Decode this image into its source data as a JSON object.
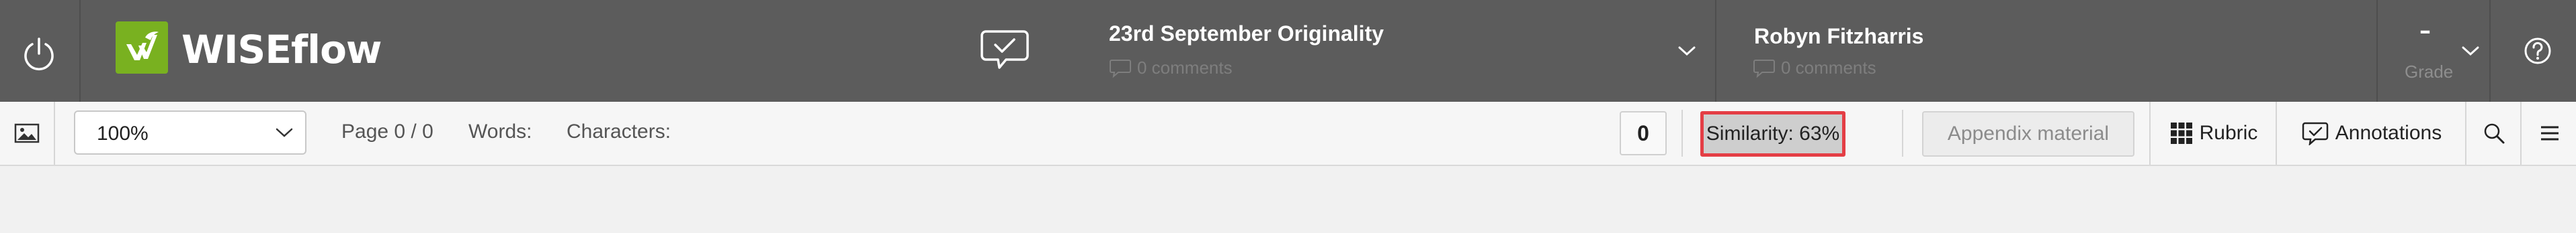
{
  "header": {
    "app_name": "WISEflow",
    "assignment": {
      "title": "23rd September Originality",
      "comments": "0 comments"
    },
    "candidate": {
      "name": "Robyn Fitzharris",
      "comments": "0 comments"
    },
    "grade": {
      "value": "–",
      "label": "Grade"
    },
    "icons": {
      "power": "power-icon",
      "logo": "wiseflow-logo-icon",
      "chat": "chat-check-icon",
      "help": "help-icon"
    }
  },
  "toolbar": {
    "zoom": "100%",
    "page": "Page 0 / 0",
    "words_label": "Words:",
    "characters_label": "Characters:",
    "count": "0",
    "similarity": "Similarity: 63%",
    "appendix": "Appendix material",
    "rubric": "Rubric",
    "annotations": "Annotations"
  },
  "colors": {
    "header_bg": "#5c5c5c",
    "logo_green": "#79b120",
    "highlight_border": "#e43e45",
    "toolbar_bg": "#f6f6f6",
    "page_bg": "#f1f1f1"
  }
}
